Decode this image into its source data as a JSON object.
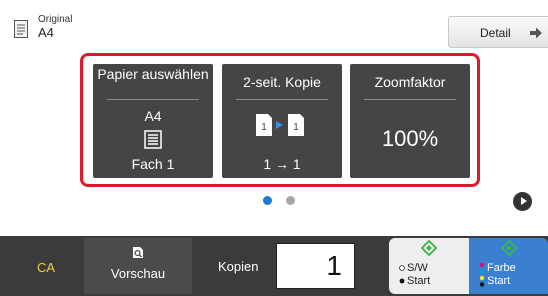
{
  "original": {
    "label": "Original",
    "size": "A4"
  },
  "detail": {
    "label": "Detail"
  },
  "tiles": {
    "paper": {
      "title": "Papier auswählen",
      "size": "A4",
      "tray": "Fach 1"
    },
    "duplex": {
      "title": "2-seit. Kopie",
      "mode": "1 → 1"
    },
    "zoom": {
      "title": "Zoomfaktor",
      "value": "100%"
    }
  },
  "pagination": {
    "current": 1,
    "total": 2
  },
  "bottom": {
    "ca": "CA",
    "preview": "Vorschau",
    "copies_label": "Kopien",
    "copies_value": "1",
    "bw": {
      "line1": "S/W",
      "line2": "Start"
    },
    "color": {
      "line1": "Farbe",
      "line2": "Start"
    }
  },
  "colors": {
    "highlight": "#e0182c",
    "accent": "#1e7ad2",
    "start_green": "#3bb54a",
    "ca_yellow": "#f4d03f"
  }
}
